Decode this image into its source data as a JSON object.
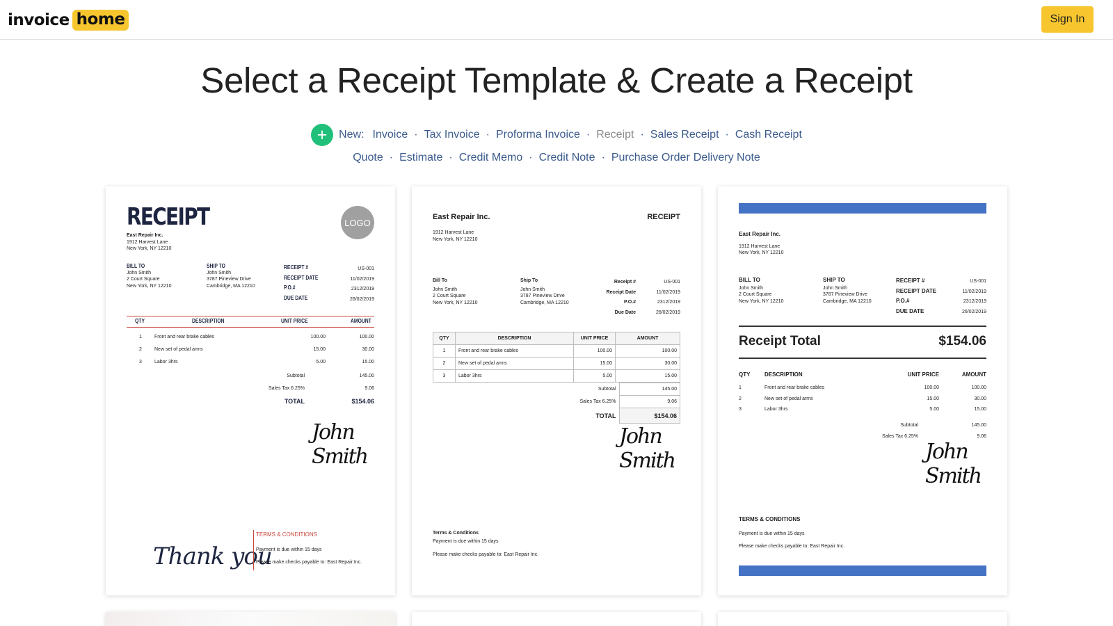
{
  "header": {
    "logo_word1": "invoice",
    "logo_word2": "home",
    "sign_in_label": "Sign In"
  },
  "page_title": "Select a Receipt Template & Create a Receipt",
  "new_menu": {
    "label": "New:",
    "row1": [
      "Invoice",
      "Tax Invoice",
      "Proforma Invoice",
      "Receipt",
      "Sales Receipt",
      "Cash Receipt"
    ],
    "row2": [
      "Quote",
      "Estimate",
      "Credit Memo",
      "Credit Note",
      "Purchase Order",
      "Delivery Note"
    ],
    "current": "Receipt"
  },
  "colors": {
    "brand_yellow": "#f7c62f",
    "plus_green": "#21c07a",
    "link_blue": "#3b5b8c",
    "accent_red": "#c9473e",
    "accent_blue": "#4472c4",
    "navy": "#1e2540"
  },
  "templates": {
    "t1": {
      "title": "RECEIPT",
      "logo": "LOGO",
      "company": "East Repair Inc.",
      "address1": "1912 Harvest Lane",
      "address2": "New York, NY 12210",
      "bill_to_label": "BILL TO",
      "bill_to": [
        "John Smith",
        "2 Court Square",
        "New York, NY 12210"
      ],
      "ship_to_label": "SHIP TO",
      "ship_to": [
        "John Smith",
        "3787 Pineview Drive",
        "Cambridge, MA 12210"
      ],
      "meta_labels": [
        "RECEIPT #",
        "RECEIPT DATE",
        "P.O.#",
        "DUE DATE"
      ],
      "meta_values": [
        "US-001",
        "11/02/2019",
        "2312/2019",
        "26/02/2019"
      ],
      "cols": [
        "QTY",
        "DESCRIPTION",
        "UNIT PRICE",
        "AMOUNT"
      ],
      "items": [
        {
          "qty": "1",
          "desc": "Front and rear brake cables",
          "price": "100.00",
          "amount": "100.00"
        },
        {
          "qty": "2",
          "desc": "New set of pedal arms",
          "price": "15.00",
          "amount": "30.00"
        },
        {
          "qty": "3",
          "desc": "Labor 3hrs",
          "price": "5.00",
          "amount": "15.00"
        }
      ],
      "subtotal_label": "Subtotal",
      "subtotal": "145.00",
      "tax_label": "Sales Tax 6.25%",
      "tax": "9.06",
      "total_label": "TOTAL",
      "total": "$154.06",
      "signature": "John Smith",
      "thank_you": "Thank you",
      "terms_title": "TERMS & CONDITIONS",
      "terms1": "Payment is due within 15 days",
      "terms2": "Please make checks payable to: East Repair Inc."
    },
    "t2": {
      "company": "East Repair Inc.",
      "title": "RECEIPT",
      "address1": "1912 Harvest Lane",
      "address2": "New York, NY 12210",
      "bill_to_label": "Bill To",
      "bill_to": [
        "John Smith",
        "2 Court Square",
        "New York, NY 12210"
      ],
      "ship_to_label": "Ship To",
      "ship_to": [
        "John Smith",
        "3787 Pineview Drive",
        "Cambridge, MA 12210"
      ],
      "meta_labels": [
        "Receipt #",
        "Receipt Date",
        "P.O.#",
        "Due Date"
      ],
      "meta_values": [
        "US-001",
        "11/02/2019",
        "2312/2019",
        "26/02/2019"
      ],
      "cols": [
        "QTY",
        "DESCRIPTION",
        "UNIT PRICE",
        "AMOUNT"
      ],
      "items": [
        {
          "qty": "1",
          "desc": "Front and rear brake cables",
          "price": "100.00",
          "amount": "100.00"
        },
        {
          "qty": "2",
          "desc": "New set of pedal arms",
          "price": "15.00",
          "amount": "30.00"
        },
        {
          "qty": "3",
          "desc": "Labor 3hrs",
          "price": "5.00",
          "amount": "15.00"
        }
      ],
      "subtotal_label": "Subtotal",
      "subtotal": "145.00",
      "tax_label": "Sales Tax 6.25%",
      "tax": "9.06",
      "total_label": "TOTAL",
      "total": "$154.06",
      "signature": "John Smith",
      "terms_title": "Terms & Conditions",
      "terms1": "Payment is due within 15 days",
      "terms2": "Please make checks payable to: East Repair Inc."
    },
    "t3": {
      "company": "East Repair Inc.",
      "address1": "1912 Harvest Lane",
      "address2": "New York, NY 12210",
      "bill_to_label": "BILL TO",
      "bill_to": [
        "John Smith",
        "2 Court Square",
        "New York, NY 12210"
      ],
      "ship_to_label": "SHIP TO",
      "ship_to": [
        "John Smith",
        "3787 Pineview Drive",
        "Cambridge, MA 12210"
      ],
      "meta_labels": [
        "RECEIPT #",
        "RECEIPT DATE",
        "P.O.#",
        "DUE DATE"
      ],
      "meta_values": [
        "US-001",
        "11/02/2019",
        "2312/2019",
        "26/02/2019"
      ],
      "receipt_total_label": "Receipt Total",
      "receipt_total": "$154.06",
      "cols": [
        "QTY",
        "DESCRIPTION",
        "UNIT PRICE",
        "AMOUNT"
      ],
      "items": [
        {
          "qty": "1",
          "desc": "Front and rear brake cables",
          "price": "100.00",
          "amount": "100.00"
        },
        {
          "qty": "2",
          "desc": "New set of pedal arms",
          "price": "15.00",
          "amount": "30.00"
        },
        {
          "qty": "3",
          "desc": "Labor 3hrs",
          "price": "5.00",
          "amount": "15.00"
        }
      ],
      "subtotal_label": "Subtotal",
      "subtotal": "145.00",
      "tax_label": "Sales Tax 6.25%",
      "tax": "9.06",
      "signature": "John Smith",
      "terms_title": "TERMS & CONDITIONS",
      "terms1": "Payment is due within 15 days",
      "terms2": "Please make checks payable to: East Repair Inc."
    }
  }
}
